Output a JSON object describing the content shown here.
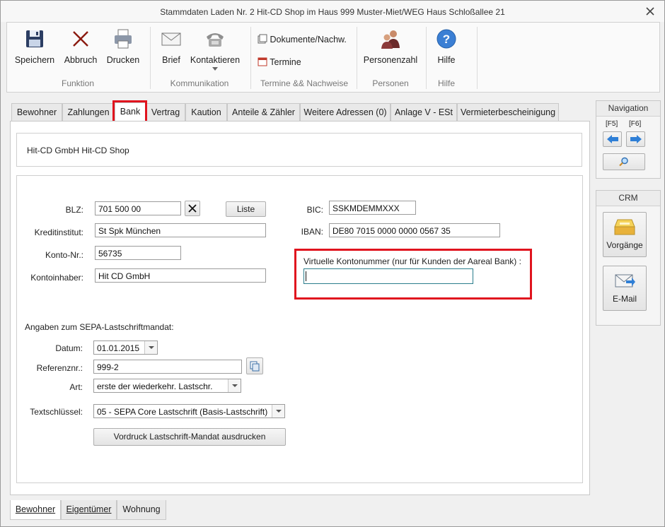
{
  "window": {
    "title": "Stammdaten Laden Nr. 2 Hit-CD Shop im Haus 999  Muster-Miet/WEG Haus Schloßallee 21"
  },
  "ribbon": {
    "speichern": "Speichern",
    "abbruch": "Abbruch",
    "drucken": "Drucken",
    "group_funktion": "Funktion",
    "brief": "Brief",
    "kontaktieren": "Kontaktieren",
    "group_kommunikation": "Kommunikation",
    "dokumente": "Dokumente/Nachw.",
    "termine": "Termine",
    "group_termine": "Termine && Nachweise",
    "personenzahl": "Personenzahl",
    "group_personen": "Personen",
    "hilfe": "Hilfe",
    "group_hilfe": "Hilfe"
  },
  "tabs": [
    "Bewohner",
    "Zahlungen",
    "Bank",
    "Vertrag",
    "Kaution",
    "Anteile & Zähler",
    "Weitere Adressen (0)",
    "Anlage V - ESt",
    "Vermieterbescheinigung"
  ],
  "header_name": "Hit-CD GmbH Hit-CD Shop",
  "bank": {
    "blz_label": "BLZ:",
    "blz_value": "701 500 00",
    "liste_label": "Liste",
    "kreditinstitut_label": "Kreditinstitut:",
    "kreditinstitut_value": "St Spk München",
    "konto_label": "Konto-Nr.:",
    "konto_value": "56735",
    "inhaber_label": "Kontoinhaber:",
    "inhaber_value": "Hit CD GmbH",
    "bic_label": "BIC:",
    "bic_value": "SSKMDEMMXXX",
    "iban_label": "IBAN:",
    "iban_value": "DE80 7015 0000 0000 0567 35",
    "virtuell_label": "Virtuelle Kontonummer (nur für Kunden der Aareal Bank) :",
    "virtuell_value": ""
  },
  "sepa": {
    "heading": "Angaben zum SEPA-Lastschriftmandat:",
    "datum_label": "Datum:",
    "datum_value": "01.01.2015",
    "ref_label": "Referenznr.:",
    "ref_value": "999-2",
    "art_label": "Art:",
    "art_value": "erste der wiederkehr. Lastschr.",
    "text_label": "Textschlüssel:",
    "text_value": "05 - SEPA Core Lastschrift (Basis-Lastschrift)",
    "print_button": "Vordruck Lastschrift-Mandat ausdrucken"
  },
  "navigation": {
    "title": "Navigation",
    "f5": "[F5]",
    "f6": "[F6]"
  },
  "crm": {
    "title": "CRM",
    "vorgaenge": "Vorgänge",
    "email": "E-Mail"
  },
  "bottom_tabs": [
    "Bewohner",
    "Eigentümer",
    "Wohnung"
  ],
  "colors": {
    "highlight": "#e0141e",
    "accent_blue": "#2f7fd6"
  }
}
